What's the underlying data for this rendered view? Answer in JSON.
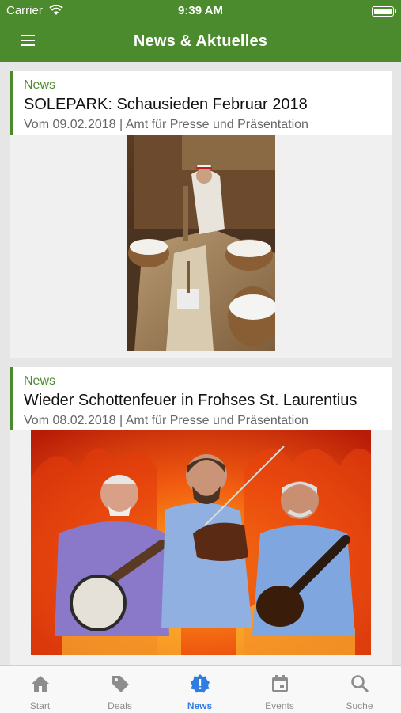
{
  "status": {
    "carrier": "Carrier",
    "time": "9:39 AM"
  },
  "header": {
    "title": "News & Aktuelles"
  },
  "articles": [
    {
      "category": "News",
      "title": "SOLEPARK: Schausieden Februar 2018",
      "meta": "Vom 09.02.2018 | Amt für Presse und Präsentation"
    },
    {
      "category": "News",
      "title": "Wieder Schottenfeuer in Frohses St. Laurentius",
      "meta": "Vom 08.02.2018 | Amt für Presse und Präsentation"
    }
  ],
  "tabs": [
    {
      "label": "Start",
      "icon": "home-icon"
    },
    {
      "label": "Deals",
      "icon": "tag-icon"
    },
    {
      "label": "News",
      "icon": "alert-badge-icon",
      "active": true
    },
    {
      "label": "Events",
      "icon": "calendar-icon"
    },
    {
      "label": "Suche",
      "icon": "search-icon"
    }
  ],
  "colors": {
    "brand": "#4c8a2e",
    "active_tab": "#2f7de1"
  }
}
